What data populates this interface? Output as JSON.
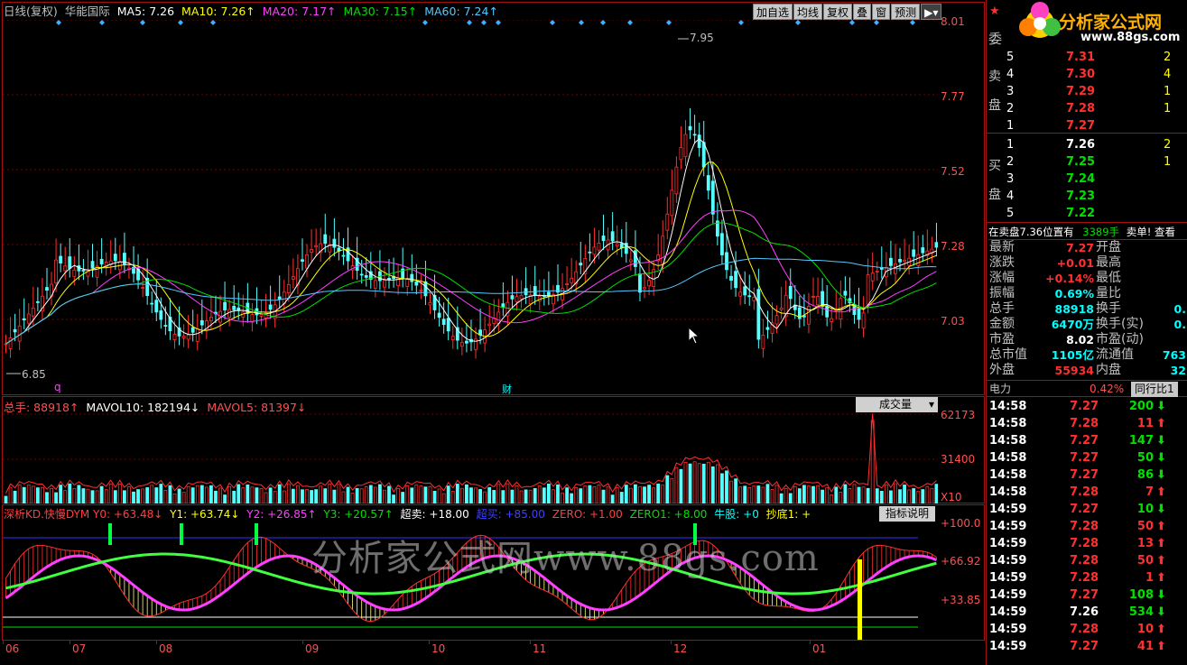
{
  "header": {
    "period": "日线(复权)",
    "stock": "华能国际",
    "ma5": "MA5: 7.26",
    "ma10": "MA10: 7.26↑",
    "ma20": "MA20: 7.17↑",
    "ma30": "MA30: 7.15↑",
    "ma60": "MA60: 7.24↑",
    "buttons": [
      "加自选",
      "均线",
      "复权",
      "叠",
      "窗",
      "预测"
    ]
  },
  "price_axis": [
    "8.01",
    "7.77",
    "7.52",
    "7.28",
    "7.03"
  ],
  "price_marks": {
    "high": "7.95",
    "low": "6.85",
    "q": "q",
    "cai": "财"
  },
  "volume": {
    "total": "总手: 88918↑",
    "mavol10": "MAVOL10: 182194↓",
    "mavol5": "MAVOL5: 81397↓",
    "selector": "成交量",
    "axis": [
      "62173",
      "31400",
      "X10"
    ]
  },
  "indicator": {
    "name": "深析KD.快慢DYM",
    "y0": "Y0: +63.48↓",
    "y1": "Y1: +63.74↓",
    "y2": "Y2: +26.85↑",
    "y3": "Y3: +20.57↑",
    "chaomai": "超卖: +18.00",
    "chaomai2": "超买: +85.00",
    "zero": "ZERO: +1.00",
    "zero1": "ZERO1: +8.00",
    "niugu": "牛股: +0",
    "chaodi": "抄底1: +",
    "button": "指标说明",
    "axis": [
      "+100.0",
      "+66.92",
      "+33.85"
    ]
  },
  "date_axis": [
    "06",
    "07",
    "08",
    "09",
    "10",
    "11",
    "12",
    "01"
  ],
  "watermark": "分析家公式网www.88gs.com",
  "logo": {
    "title": "分析家公式网",
    "url": "www.88gs.com"
  },
  "order_book": {
    "label_top": "委",
    "sell_label": [
      "卖",
      "盘"
    ],
    "buy_label": [
      "买",
      "盘"
    ],
    "sell": [
      {
        "lvl": "5",
        "price": "7.31",
        "vol": "2"
      },
      {
        "lvl": "4",
        "price": "7.30",
        "vol": "4"
      },
      {
        "lvl": "3",
        "price": "7.29",
        "vol": "1"
      },
      {
        "lvl": "2",
        "price": "7.28",
        "vol": "1"
      },
      {
        "lvl": "1",
        "price": "7.27",
        "vol": ""
      }
    ],
    "buy": [
      {
        "lvl": "1",
        "price": "7.26",
        "vol": "2"
      },
      {
        "lvl": "2",
        "price": "7.25",
        "vol": "1"
      },
      {
        "lvl": "3",
        "price": "7.24",
        "vol": ""
      },
      {
        "lvl": "4",
        "price": "7.23",
        "vol": ""
      },
      {
        "lvl": "5",
        "price": "7.22",
        "vol": ""
      }
    ],
    "notice": "在卖盘7.36位置有",
    "notice_vol": "3389手",
    "notice_link": "卖单! 查看"
  },
  "quote": [
    {
      "k": "最新",
      "v": "7.27",
      "k2": "开盘",
      "v2": ""
    },
    {
      "k": "涨跌",
      "v": "+0.01",
      "k2": "最高",
      "v2": ""
    },
    {
      "k": "涨幅",
      "v": "+0.14%",
      "k2": "最低",
      "v2": ""
    },
    {
      "k": "振幅",
      "v": "0.69%",
      "k2": "量比",
      "v2": ""
    },
    {
      "k": "总手",
      "v": "88918",
      "k2": "换手",
      "v2": "0."
    },
    {
      "k": "金额",
      "v": "6470万",
      "k2": "换手(实)",
      "v2": "0."
    },
    {
      "k": "市盈",
      "v": "8.02",
      "k2": "市盈(动)",
      "v2": ""
    },
    {
      "k": "总市值",
      "v": "1105亿",
      "k2": "流通值",
      "v2": "763"
    },
    {
      "k": "外盘",
      "v": "55934",
      "k2": "内盘",
      "v2": "32"
    }
  ],
  "sector": {
    "name": "电力",
    "pct": "0.42%",
    "btn": "同行比1"
  },
  "ticks": [
    {
      "t": "14:58",
      "p": "7.27",
      "v": "200"
    },
    {
      "t": "14:58",
      "p": "7.28",
      "v": "11"
    },
    {
      "t": "14:58",
      "p": "7.27",
      "v": "147"
    },
    {
      "t": "14:58",
      "p": "7.27",
      "v": "50"
    },
    {
      "t": "14:58",
      "p": "7.27",
      "v": "86"
    },
    {
      "t": "14:58",
      "p": "7.28",
      "v": "7"
    },
    {
      "t": "14:59",
      "p": "7.27",
      "v": "10"
    },
    {
      "t": "14:59",
      "p": "7.28",
      "v": "50"
    },
    {
      "t": "14:59",
      "p": "7.28",
      "v": "13"
    },
    {
      "t": "14:59",
      "p": "7.28",
      "v": "50"
    },
    {
      "t": "14:59",
      "p": "7.28",
      "v": "1"
    },
    {
      "t": "14:59",
      "p": "7.27",
      "v": "108"
    },
    {
      "t": "14:59",
      "p": "7.26",
      "v": "534"
    },
    {
      "t": "14:59",
      "p": "7.28",
      "v": "10"
    },
    {
      "t": "14:59",
      "p": "7.27",
      "v": "41"
    }
  ],
  "tick_dirs": [
    "down",
    "up",
    "down",
    "down",
    "down",
    "up",
    "down",
    "up",
    "up",
    "up",
    "up",
    "down",
    "down",
    "up",
    "up"
  ],
  "colors": {
    "up": "#ff3030",
    "down": "#00e000",
    "frame": "#a01010",
    "cyan": "#54ffff"
  }
}
